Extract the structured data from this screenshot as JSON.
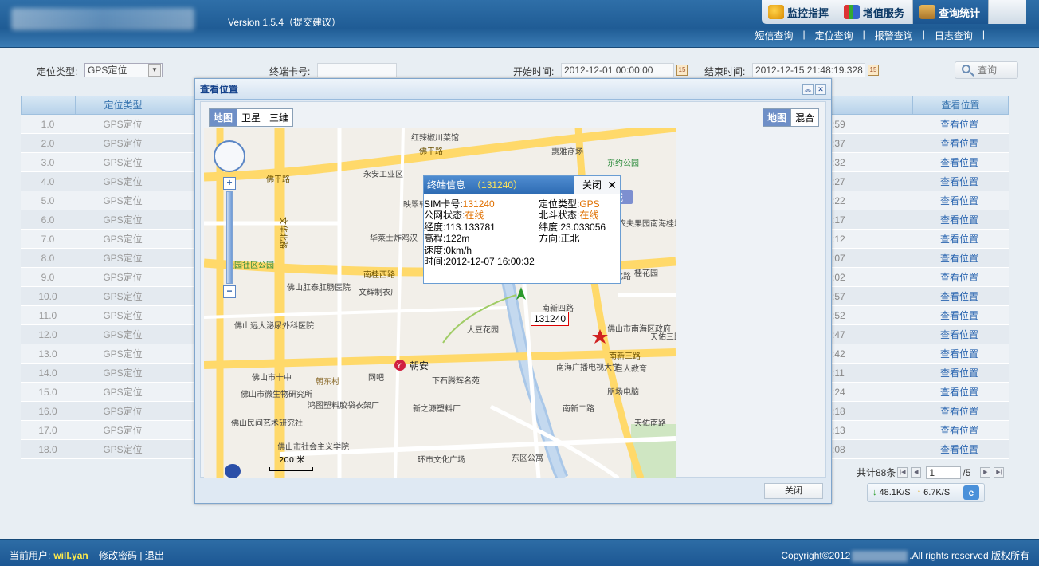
{
  "app": {
    "version": "Version 1.5.4（提交建议）",
    "main_nav": [
      {
        "label": "监控指挥",
        "icon": "monitor-icon",
        "active": false
      },
      {
        "label": "增值服务",
        "icon": "chart-icon",
        "active": false
      },
      {
        "label": "查询统计",
        "icon": "briefcase-icon",
        "active": true
      }
    ],
    "sub_nav": [
      "短信查询",
      "|",
      "定位查询",
      "|",
      "报警查询",
      "|",
      "日志查询",
      "|"
    ]
  },
  "filter": {
    "loc_type_label": "定位类型:",
    "loc_type_value": "GPS定位",
    "card_label": "终端卡号:",
    "card_value": "",
    "start_label": "开始时间:",
    "start_value": "2012-12-01 00:00:00",
    "end_label": "结束时间:",
    "end_value": "2012-12-15 21:48:19.328",
    "search_label": "查询",
    "calendar_icon_text": "15"
  },
  "table": {
    "col_type": "定位类型",
    "col_view": "查看位置",
    "rows": [
      {
        "no": "1.0",
        "type": "GPS定位",
        "time": ":59",
        "view": "查看位置"
      },
      {
        "no": "2.0",
        "type": "GPS定位",
        "time": ":37",
        "view": "查看位置"
      },
      {
        "no": "3.0",
        "type": "GPS定位",
        "time": ":32",
        "view": "查看位置"
      },
      {
        "no": "4.0",
        "type": "GPS定位",
        "time": ":27",
        "view": "查看位置"
      },
      {
        "no": "5.0",
        "type": "GPS定位",
        "time": ":22",
        "view": "查看位置"
      },
      {
        "no": "6.0",
        "type": "GPS定位",
        "time": ":17",
        "view": "查看位置"
      },
      {
        "no": "7.0",
        "type": "GPS定位",
        "time": ":12",
        "view": "查看位置"
      },
      {
        "no": "8.0",
        "type": "GPS定位",
        "time": ":07",
        "view": "查看位置"
      },
      {
        "no": "9.0",
        "type": "GPS定位",
        "time": ":02",
        "view": "查看位置"
      },
      {
        "no": "10.0",
        "type": "GPS定位",
        "time": ":57",
        "view": "查看位置"
      },
      {
        "no": "11.0",
        "type": "GPS定位",
        "time": ":52",
        "view": "查看位置"
      },
      {
        "no": "12.0",
        "type": "GPS定位",
        "time": ":47",
        "view": "查看位置"
      },
      {
        "no": "13.0",
        "type": "GPS定位",
        "time": ":42",
        "view": "查看位置"
      },
      {
        "no": "14.0",
        "type": "GPS定位",
        "time": ":11",
        "view": "查看位置"
      },
      {
        "no": "15.0",
        "type": "GPS定位",
        "time": ":24",
        "view": "查看位置"
      },
      {
        "no": "16.0",
        "type": "GPS定位",
        "time": ":18",
        "view": "查看位置"
      },
      {
        "no": "17.0",
        "type": "GPS定位",
        "time": ":13",
        "view": "查看位置"
      },
      {
        "no": "18.0",
        "type": "GPS定位",
        "time": ":08",
        "view": "查看位置"
      }
    ]
  },
  "pager": {
    "total": "共计88条",
    "page": "1",
    "of": "/5"
  },
  "speed": {
    "down": "48.1K/S",
    "up": "6.7K/S",
    "ie": "e"
  },
  "footer": {
    "user_label": "当前用户:",
    "user_name": "will.yan",
    "change_pwd": "修改密码",
    "sep": "|",
    "logout": "退出",
    "copyright_pre": "Copyright©2012",
    "copyright_post": ".All rights reserved 版权所有"
  },
  "dialog": {
    "title": "查看位置",
    "map_types": [
      "地图",
      "卫星",
      "三维"
    ],
    "map_types2": [
      "地图",
      "混合"
    ],
    "close_button": "关闭",
    "info": {
      "title": "终端信息",
      "id": "（131240）",
      "close": "关闭",
      "sim_label": "SIM卡号:",
      "sim_value": "131240",
      "loc_type_label": "定位类型:",
      "loc_type_value": "GPS",
      "net_label": "公网状态:",
      "net_value": "在线",
      "bd_label": "北斗状态:",
      "bd_value": "在线",
      "lng": "经度:113.133781",
      "lat": "纬度:23.033056",
      "alt": "高程:122m",
      "dir": "方向:正北",
      "speed": "速度:0km/h",
      "time": "时间:2012-12-07 16:00:32"
    },
    "marker_label": "131240",
    "scale": "200 米",
    "map_labels": {
      "l1": "红辣椒川菜馆",
      "l2": "佛平路",
      "l3": "惠雅商场",
      "l4": "东约公园",
      "l5": "永安工业区",
      "l6": "佛平路",
      "l7": "文华北路",
      "l8": "映翠轩",
      "l9": "华莱士炸鸡汉",
      "l10": "桂园社区公园",
      "l11": "南桂西路",
      "l12": "佛山肛泰肛肠医院",
      "l13": "文辉制衣厂",
      "l14": "南新四路",
      "l15": "大豆花园",
      "l16": "佛山远大泌尿外科医院",
      "l17": "佛山市南海区政府",
      "l18": "南新三路",
      "l19": "朝安",
      "l20": "佛山市十中",
      "l21": "网吧",
      "l22": "下石腾辉名苑",
      "l23": "南海广播电视大学",
      "l24": "巨人教育",
      "l25": "佛山市微生物研究所",
      "l26": "鸿图塑料胶袋衣架厂",
      "l27": "朋场电脑",
      "l28": "新之源塑料厂",
      "l29": "南新二路",
      "l30": "佛山民间艺术研究社",
      "l31": "佛山市社会主义学院",
      "l32": "环市文化广场",
      "l33": "东区公寓",
      "l34": "天佑南路",
      "l35": "桂花园",
      "l36": "农夫果园南海桂城店",
      "l37": "朝东村",
      "l38": "城",
      "l39": "天佑三路",
      "l40": "佑北路"
    }
  }
}
